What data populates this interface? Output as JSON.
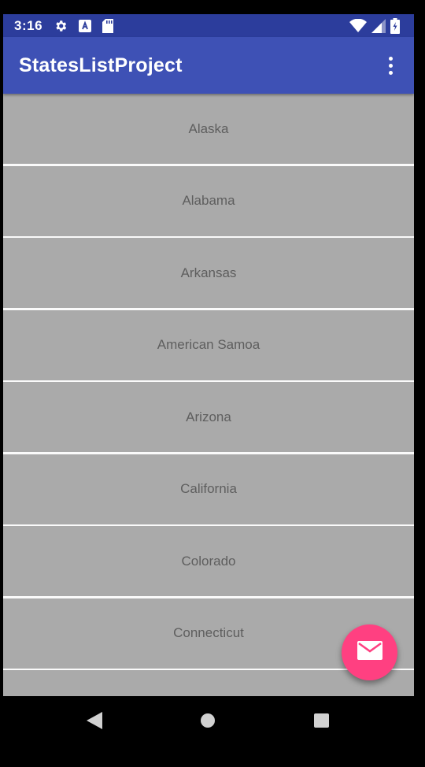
{
  "status_bar": {
    "time": "3:16",
    "icons": [
      "settings-gear-icon",
      "a-box-icon",
      "sd-card-icon",
      "wifi-icon",
      "cell-signal-icon",
      "battery-icon"
    ]
  },
  "app_bar": {
    "title": "StatesListProject",
    "menu_icon": "overflow-menu-icon"
  },
  "states": [
    "Alaska",
    "Alabama",
    "Arkansas",
    "American Samoa",
    "Arizona",
    "California",
    "Colorado",
    "Connecticut"
  ],
  "fab": {
    "icon": "email-icon"
  },
  "nav_bar": {
    "icons": [
      "back-icon",
      "home-icon",
      "recents-icon"
    ]
  },
  "colors": {
    "status_bar": "#2c3d9c",
    "app_bar": "#3e51b5",
    "list_item": "#aaaaaa",
    "list_text": "#5e5e5e",
    "fab": "#ff4081"
  }
}
